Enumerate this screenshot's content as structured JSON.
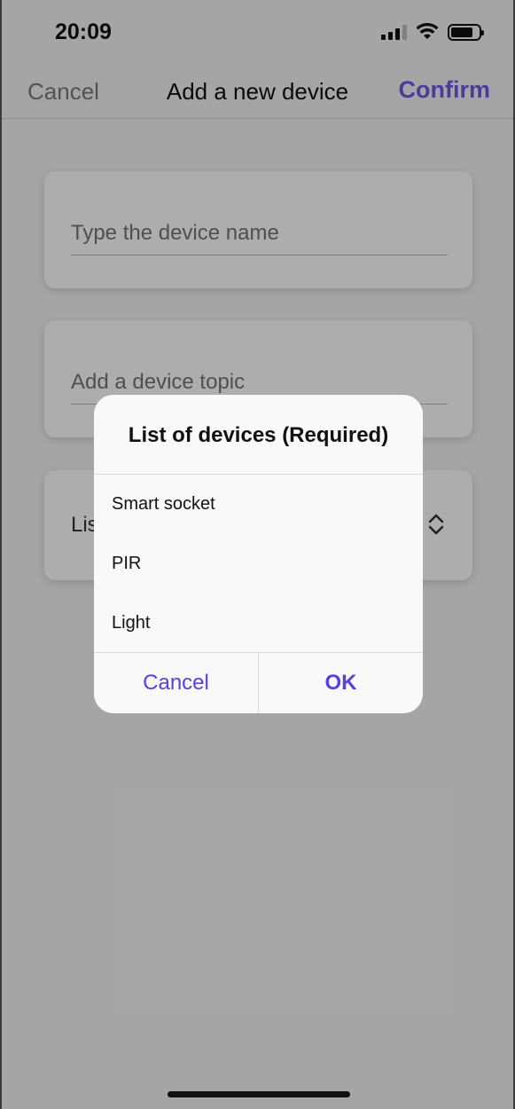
{
  "status_bar": {
    "time": "20:09"
  },
  "navbar": {
    "cancel_label": "Cancel",
    "title": "Add a new device",
    "confirm_label": "Confirm"
  },
  "form": {
    "name_placeholder": "Type the device name",
    "topic_placeholder": "Add a device topic",
    "list_select_visible_text": "Lis"
  },
  "dialog": {
    "title": "List of devices (Required)",
    "options": [
      "Smart socket",
      "PIR",
      "Light"
    ],
    "cancel_label": "Cancel",
    "ok_label": "OK"
  },
  "colors": {
    "accent": "#5a3fe0",
    "overlay": "rgba(0,0,0,0.32)"
  }
}
